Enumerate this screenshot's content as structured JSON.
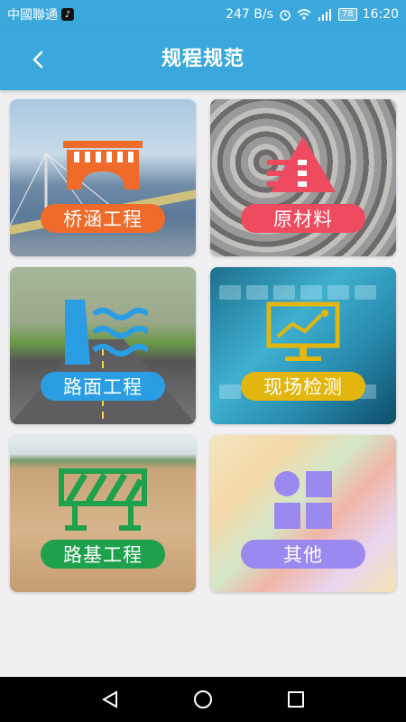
{
  "status_bar": {
    "carrier": "中國聯通",
    "app_icon": "tiktok-icon",
    "net_speed": "247 B/s",
    "battery": "78",
    "time": "16:20"
  },
  "header": {
    "title": "规程规范"
  },
  "tiles": [
    {
      "label": "桥涵工程",
      "icon": "bridge-icon",
      "color": "#f06a2a"
    },
    {
      "label": "原材料",
      "icon": "triangle-layers-icon",
      "color": "#ef4b5f"
    },
    {
      "label": "路面工程",
      "icon": "dam-water-icon",
      "color": "#2b9de3"
    },
    {
      "label": "现场检测",
      "icon": "monitor-chart-icon",
      "color": "#e2b60f"
    },
    {
      "label": "路基工程",
      "icon": "barrier-icon",
      "color": "#1ea14c"
    },
    {
      "label": "其他",
      "icon": "grid-blocks-icon",
      "color": "#9a8af0"
    }
  ]
}
